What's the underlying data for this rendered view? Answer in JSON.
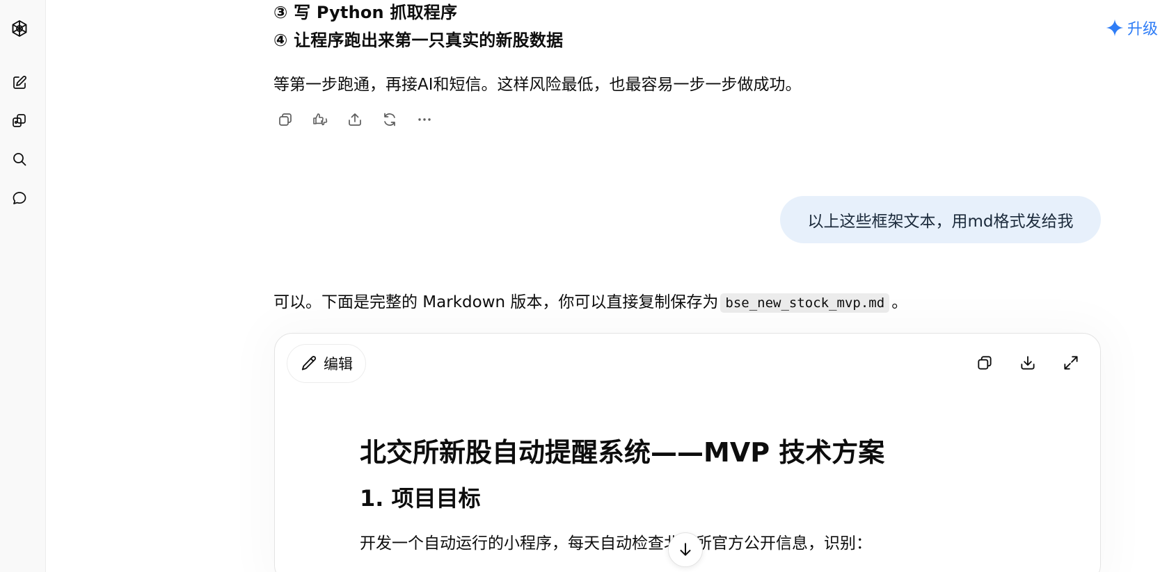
{
  "sidebar": {
    "icons": [
      "openai-logo-icon",
      "new-chat-icon",
      "library-icon",
      "search-icon",
      "chat-bubble-icon"
    ]
  },
  "header": {
    "upgrade_label": "升级"
  },
  "assistant_prev": {
    "step3": "③ 写 Python 抓取程序",
    "step4": "④ 让程序跑出来第一只真实的新股数据",
    "closing": "等第一步跑通，再接AI和短信。这样风险最低，也最容易一步一步做成功。",
    "actions": [
      "copy-icon",
      "thumbs-icon",
      "share-icon",
      "regenerate-icon",
      "more-icon"
    ]
  },
  "user_message": {
    "text": "以上这些框架文本，用md格式发给我"
  },
  "assistant_reply": {
    "intro_before": "可以。下面是完整的 Markdown 版本，你可以直接复制保存为",
    "filename": "bse_new_stock_mvp.md",
    "intro_after": "。"
  },
  "canvas": {
    "edit_label": "编辑",
    "tools": [
      "copy-icon",
      "download-icon",
      "expand-icon"
    ],
    "doc_title": "北交所新股自动提醒系统——MVP 技术方案",
    "section_heading": "1. 项目目标",
    "section_text": "开发一个自动运行的小程序，每天自动检查北交所官方公开信息，识别："
  },
  "colors": {
    "accent": "#2f7df6",
    "bubble": "#e7f0fb",
    "text": "#0d0d0d"
  }
}
